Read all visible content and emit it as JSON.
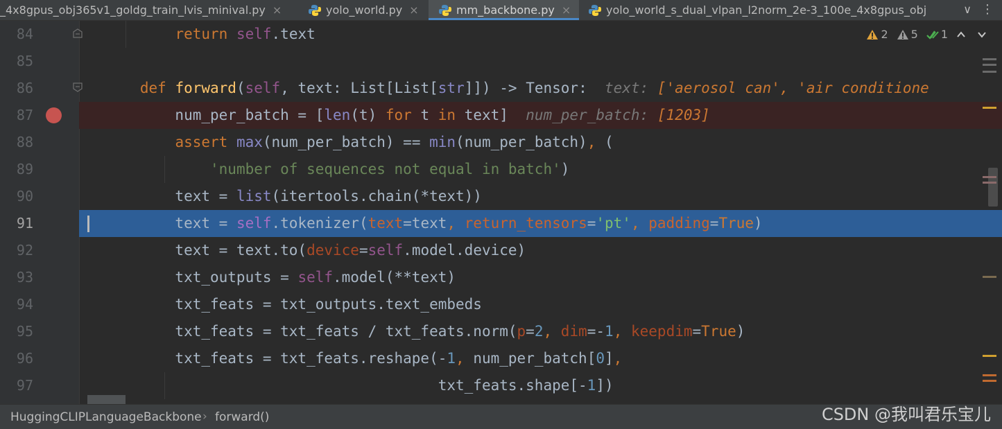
{
  "tabs": [
    {
      "label": "_4x8gpus_obj365v1_goldg_train_lvis_minival.py",
      "active": false,
      "closable": true
    },
    {
      "label": "yolo_world.py",
      "active": false,
      "closable": true
    },
    {
      "label": "mm_backbone.py",
      "active": true,
      "closable": true
    },
    {
      "label": "yolo_world_s_dual_vlpan_l2norm_2e-3_100e_4x8gpus_obj",
      "active": false,
      "closable": false
    }
  ],
  "tab_close_glyph": "×",
  "tab_menu_glyph": "∨",
  "tab_more_glyph": "⋮",
  "inspections": {
    "warnings_count": "2",
    "weak_warnings_count": "5",
    "typos_count": "1"
  },
  "editor": {
    "lines": [
      {
        "num": "84"
      },
      {
        "num": "85"
      },
      {
        "num": "86"
      },
      {
        "num": "87"
      },
      {
        "num": "88"
      },
      {
        "num": "89"
      },
      {
        "num": "90"
      },
      {
        "num": "91"
      },
      {
        "num": "92"
      },
      {
        "num": "93"
      },
      {
        "num": "94"
      },
      {
        "num": "95"
      },
      {
        "num": "96"
      },
      {
        "num": "97"
      }
    ],
    "breakpoint_line": "87",
    "current_line": "91",
    "inline_hints": {
      "line86_label": "text:",
      "line86_value": "['aerosol can', 'air conditione",
      "line87_label": "num_per_batch:",
      "line87_value": "[1203]"
    }
  },
  "breadcrumb": {
    "class_name": "HuggingCLIPLanguageBackbone",
    "separator": "›",
    "method_name": "forward()"
  },
  "watermark": "CSDN @我叫君乐宝儿",
  "colors": {
    "keyword": "#cc7832",
    "function": "#ffc66d",
    "self": "#94558d",
    "builtin": "#8888c6",
    "string": "#6a8759",
    "number": "#6897bb",
    "current_line_bg": "#2d5e97",
    "breakpoint": "#c75450"
  }
}
